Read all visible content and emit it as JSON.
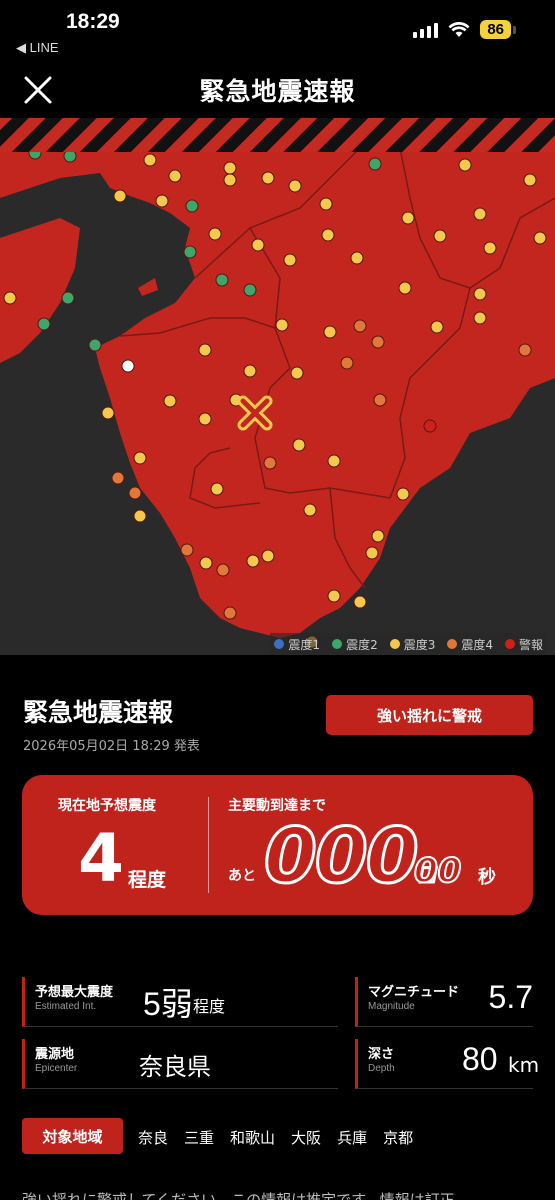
{
  "status_bar": {
    "time": "18:29",
    "back_app": "◀ LINE",
    "battery": "86"
  },
  "header": {
    "title": "緊急地震速報",
    "close_icon": "close-icon"
  },
  "map": {
    "epicenter_icon": "epicenter-x-icon",
    "legend": [
      {
        "label": "震度1",
        "color": "#3a6fc4"
      },
      {
        "label": "震度2",
        "color": "#3fa66a"
      },
      {
        "label": "震度3",
        "color": "#f2c94c"
      },
      {
        "label": "震度4",
        "color": "#e0783a"
      },
      {
        "label": "警報",
        "color": "#d0201a"
      }
    ],
    "colors": {
      "land": "#c3261f",
      "sea": "#2a2a2a",
      "border": "#7a1a16"
    }
  },
  "alert": {
    "title": "緊急地震速報",
    "issued": "2026年05月02日 18:29 発表",
    "warning_button": "強い揺れに警戒"
  },
  "forecast_card": {
    "local_label": "現在地予想震度",
    "local_intensity": "4",
    "local_intensity_unit": "程度",
    "arrival_label": "主要動到達まで",
    "arrival_prefix": "あと",
    "arrival_seconds_main": "000.",
    "arrival_seconds_fraction": "00",
    "arrival_unit": "秒"
  },
  "stats": {
    "max_intensity": {
      "label": "予想最大震度",
      "sub": "Estimated Int.",
      "value": "5弱",
      "unit": "程度"
    },
    "magnitude": {
      "label": "マグニチュード",
      "sub": "Magnitude",
      "value": "5.7"
    },
    "epicenter": {
      "label": "震源地",
      "sub": "Epicenter",
      "value": "奈良県"
    },
    "depth": {
      "label": "深さ",
      "sub": "Depth",
      "value": "80",
      "unit": "km"
    }
  },
  "regions": {
    "label": "対象地域",
    "items": [
      "奈良",
      "三重",
      "和歌山",
      "大阪",
      "兵庫",
      "京都"
    ]
  },
  "footer": {
    "text": "強い揺れに警戒してください。この情報は推定です。情報は訂正"
  },
  "accent_color": "#c0221c"
}
